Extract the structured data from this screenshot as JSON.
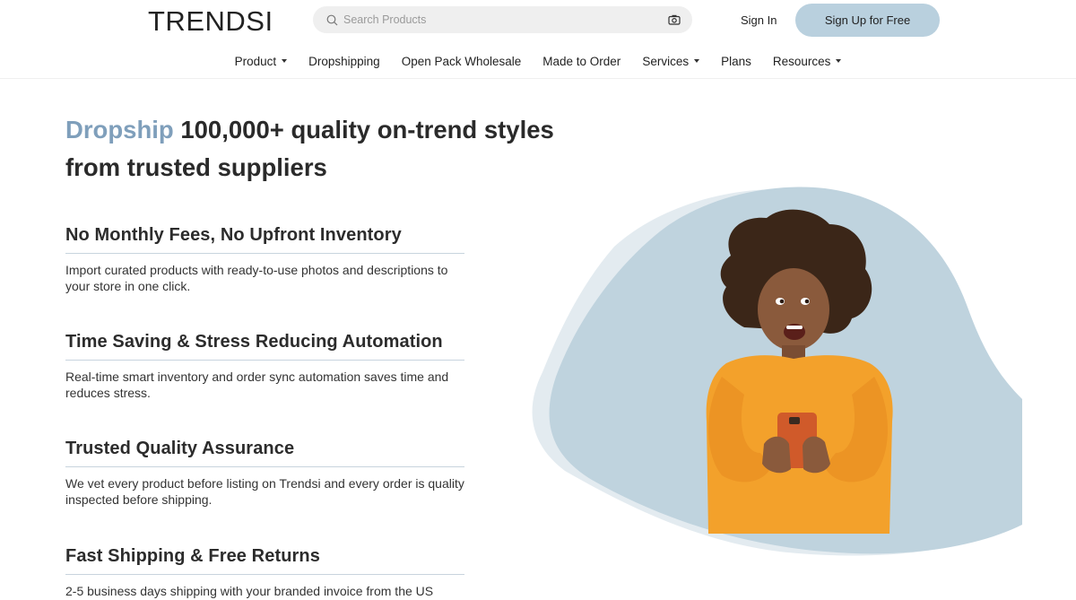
{
  "header": {
    "logo": "TRENDSI",
    "search_placeholder": "Search Products",
    "signin_label": "Sign In",
    "signup_label": "Sign Up for Free"
  },
  "nav": {
    "items": [
      {
        "label": "Product",
        "dropdown": true
      },
      {
        "label": "Dropshipping",
        "dropdown": false
      },
      {
        "label": "Open Pack Wholesale",
        "dropdown": false
      },
      {
        "label": "Made to Order",
        "dropdown": false
      },
      {
        "label": "Services",
        "dropdown": true
      },
      {
        "label": "Plans",
        "dropdown": false
      },
      {
        "label": "Resources",
        "dropdown": true
      }
    ]
  },
  "hero": {
    "title_accent": "Dropship",
    "title_rest": " 100,000+ quality on-trend styles from trusted suppliers"
  },
  "features": [
    {
      "title": "No Monthly Fees, No Upfront Inventory",
      "text": "Import curated products with ready-to-use photos and descriptions to your store in one click."
    },
    {
      "title": "Time Saving & Stress Reducing Automation",
      "text": "Real-time smart inventory and order sync automation saves time and reduces stress."
    },
    {
      "title": "Trusted Quality Assurance",
      "text": "We vet every product before listing on Trendsi and every order is quality inspected before shipping."
    },
    {
      "title": "Fast Shipping & Free Returns",
      "text": "2-5 business days shipping with your branded invoice from the US"
    }
  ],
  "colors": {
    "accent": "#7f9fbb",
    "button_bg": "#b9d0de",
    "blob": "#bfd3de",
    "blob_back": "#e3ebf0",
    "sweater": "#f3a12b"
  },
  "icons": {
    "search": "search-icon",
    "camera": "camera-icon",
    "caret": "caret-down-icon"
  }
}
